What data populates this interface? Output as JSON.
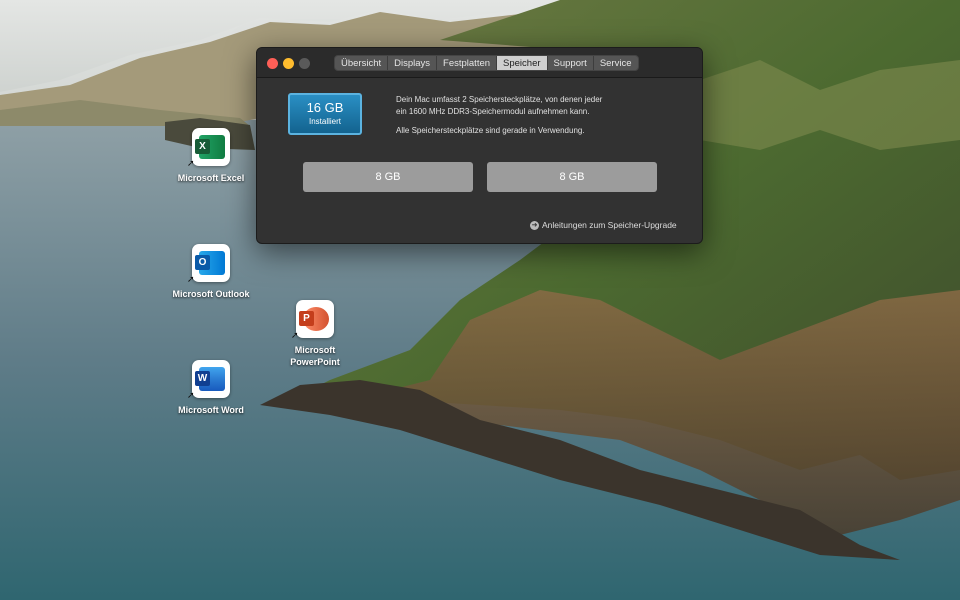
{
  "window": {
    "tabs": [
      {
        "label": "Übersicht",
        "active": false
      },
      {
        "label": "Displays",
        "active": false
      },
      {
        "label": "Festplatten",
        "active": false
      },
      {
        "label": "Speicher",
        "active": true
      },
      {
        "label": "Support",
        "active": false
      },
      {
        "label": "Service",
        "active": false
      }
    ],
    "memory": {
      "total": "16 GB",
      "status": "Installiert",
      "description_line1": "Dein Mac umfasst 2 Speichersteckplätze, von denen jeder",
      "description_line2": "ein 1600 MHz DDR3-Speichermodul aufnehmen kann.",
      "usage_note": "Alle Speichersteckplätze sind gerade in Verwendung.",
      "slots": [
        "8 GB",
        "8 GB"
      ],
      "upgrade_link": "Anleitungen zum Speicher-Upgrade"
    },
    "colors": {
      "close": "#fe5f57",
      "minimize": "#febc2e",
      "zoom_disabled": "#5a5a5a",
      "badge": "#1f7db0"
    }
  },
  "desktop": {
    "icons": [
      {
        "label": "Microsoft Excel",
        "icon": "excel-icon",
        "letter": "X",
        "color": "#1d6f42"
      },
      {
        "label": "Microsoft Outlook",
        "icon": "outlook-icon",
        "letter": "O",
        "color": "#0f6cbd"
      },
      {
        "label": "Microsoft PowerPoint",
        "icon": "powerpoint-icon",
        "letter": "P",
        "color": "#c43e1c"
      },
      {
        "label": "Microsoft Word",
        "icon": "word-icon",
        "letter": "W",
        "color": "#185abd"
      }
    ]
  }
}
